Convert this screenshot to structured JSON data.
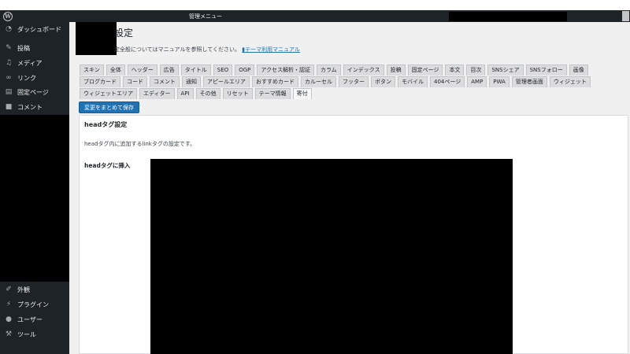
{
  "adminbar": {
    "title": "管理メニュー"
  },
  "sidebar": {
    "top_items": [
      {
        "label": "ダッシュボード",
        "icon": "dashboard-icon"
      },
      {
        "label": "投稿",
        "icon": "pin-icon"
      },
      {
        "label": "メディア",
        "icon": "media-icon"
      },
      {
        "label": "リンク",
        "icon": "link-icon"
      },
      {
        "label": "固定ページ",
        "icon": "page-icon"
      },
      {
        "label": "コメント",
        "icon": "comment-icon"
      }
    ],
    "bottom_items": [
      {
        "label": "外観",
        "icon": "brush-icon"
      },
      {
        "label": "プラグイン",
        "icon": "plugin-icon"
      },
      {
        "label": "ユーザー",
        "icon": "user-icon"
      },
      {
        "label": "ツール",
        "icon": "wrench-icon"
      }
    ]
  },
  "main": {
    "page_title": "設定",
    "intro_text": "定全般についてはマニュアルを参照してください。",
    "manual_link": "テーマ利用マニュアル",
    "tab_rows": [
      [
        "スキン",
        "全体",
        "ヘッダー",
        "広告",
        "タイトル",
        "SEO",
        "OGP",
        "アクセス解析・認証",
        "カラム",
        "インデックス",
        "投稿",
        "固定ページ",
        "本文",
        "目次",
        "SNSシェア",
        "SNSフォロー",
        "画像"
      ],
      [
        "ブログカード",
        "コード",
        "コメント",
        "通知",
        "アピールエリア",
        "おすすめカード",
        "カルーセル",
        "フッター",
        "ボタン",
        "モバイル",
        "404ページ",
        "AMP",
        "PWA",
        "管理者画面",
        "ウィジェット"
      ],
      [
        "ウィジェットエリア",
        "エディター",
        "API",
        "その他",
        "リセット",
        "テーマ情報",
        "寄付"
      ]
    ],
    "active_tab": "寄付",
    "save_button": "変更をまとめて保存",
    "panel": {
      "title": "headタグ設定",
      "description": "headタグ内に追加するlinkタグの設定です。",
      "field_label": "headタグに挿入"
    }
  },
  "colors": {
    "sidebar_bg": "#1d2327",
    "accent": "#2271b1",
    "content_bg": "#f0f0f1"
  }
}
